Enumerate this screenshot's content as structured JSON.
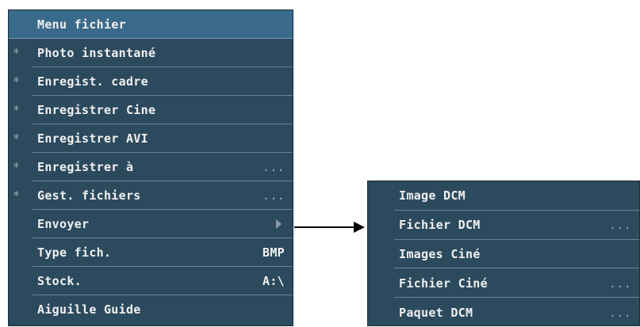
{
  "main_menu": {
    "title": "Menu fichier",
    "items": [
      {
        "label": "Photo instantané",
        "star": "*",
        "value": "",
        "more": ""
      },
      {
        "label": "Enregist. cadre",
        "star": "*",
        "value": "",
        "more": ""
      },
      {
        "label": "Enregistrer Cine",
        "star": "*",
        "value": "",
        "more": ""
      },
      {
        "label": "Enregistrer AVI",
        "star": "*",
        "value": "",
        "more": ""
      },
      {
        "label": "Enregistrer à",
        "star": "*",
        "value": "",
        "more": "..."
      },
      {
        "label": "Gest. fichiers",
        "star": "*",
        "value": "",
        "more": "..."
      },
      {
        "label": "Envoyer",
        "star": "",
        "value": "",
        "more": ""
      },
      {
        "label": "Type fich.",
        "star": "",
        "value": "BMP",
        "more": ""
      },
      {
        "label": "Stock.",
        "star": "",
        "value": "A:\\",
        "more": ""
      },
      {
        "label": "Aiguille Guide",
        "star": "",
        "value": "",
        "more": ""
      }
    ]
  },
  "sub_menu": {
    "items": [
      {
        "label": "Image DCM",
        "more": ""
      },
      {
        "label": "Fichier DCM",
        "more": "..."
      },
      {
        "label": "Images Ciné",
        "more": ""
      },
      {
        "label": "Fichier Ciné",
        "more": "..."
      },
      {
        "label": "Paquet DCM",
        "more": "..."
      }
    ]
  },
  "colors": {
    "menu_bg": "#2c4a5e",
    "title_bg": "#3a6a8a",
    "divider": "#6a8394",
    "text": "#f0f0f0"
  },
  "icons": {
    "submenu_arrow": "triangle-right-icon",
    "connector_arrow": "arrow-right-icon"
  }
}
